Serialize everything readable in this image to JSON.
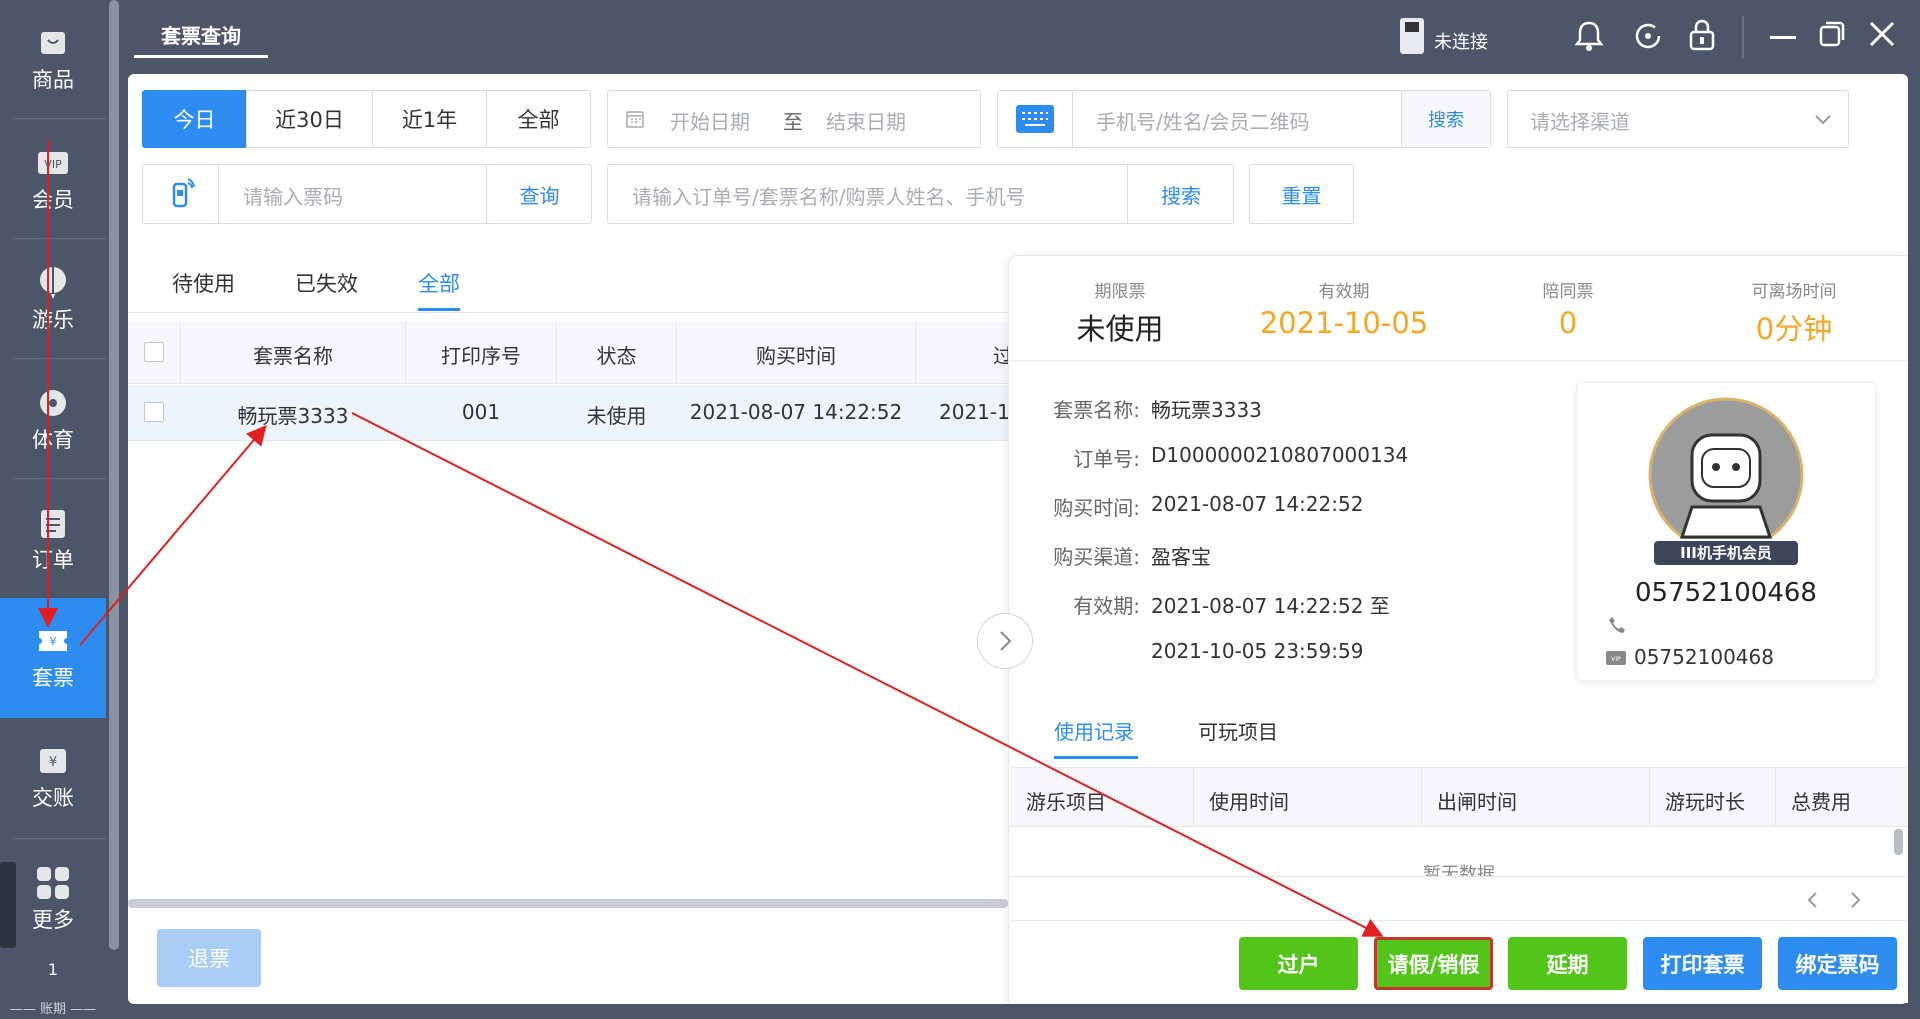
{
  "sidebar": {
    "items": [
      {
        "label": "商品",
        "icon": "shopping-bag-icon"
      },
      {
        "label": "会员",
        "icon": "vip-card-icon"
      },
      {
        "label": "游乐",
        "icon": "balloon-icon"
      },
      {
        "label": "体育",
        "icon": "ball-icon"
      },
      {
        "label": "订单",
        "icon": "clipboard-icon"
      },
      {
        "label": "套票",
        "icon": "ticket-icon"
      },
      {
        "label": "交账",
        "icon": "yen-note-icon"
      },
      {
        "label": "更多",
        "icon": "grid-icon"
      }
    ],
    "active_index": 5,
    "page_number": "1",
    "footer": "—— 账期 ——"
  },
  "header": {
    "tab": "套票查询",
    "device_status": "未连接"
  },
  "filters": {
    "range_buttons": [
      "今日",
      "近30日",
      "近1年",
      "全部"
    ],
    "active_range": 0,
    "start_date": "开始日期",
    "to": "至",
    "end_date": "结束日期",
    "member_placeholder": "手机号/姓名/会员二维码",
    "member_search": "搜索",
    "channel_placeholder": "请选择渠道",
    "ticket_code_placeholder": "请输入票码",
    "query": "查询",
    "order_placeholder": "请输入订单号/套票名称/购票人姓名、手机号",
    "search": "搜索",
    "reset": "重置"
  },
  "status_tabs": [
    "待使用",
    "已失效",
    "全部"
  ],
  "active_status_tab": 2,
  "table": {
    "columns": [
      "套票名称",
      "打印序号",
      "状态",
      "购买时间",
      "过"
    ],
    "rows": [
      {
        "name": "畅玩票3333",
        "serial": "001",
        "status": "未使用",
        "buy_time": "2021-08-07 14:22:52",
        "partial": "2021-1("
      }
    ]
  },
  "refund_button": "退票",
  "detail": {
    "summary": [
      {
        "caption": "期限票",
        "value": "未使用",
        "color": "#222222"
      },
      {
        "caption": "有效期",
        "value": "2021-10-05",
        "color": "#f5a623"
      },
      {
        "caption": "陪同票",
        "value": "0",
        "color": "#f5a623"
      },
      {
        "caption": "可离场时间",
        "value": "0分钟",
        "color": "#f5a623"
      }
    ],
    "fields": [
      {
        "label": "套票名称:",
        "value": "畅玩票3333"
      },
      {
        "label": "订单号:",
        "value": "D1000000210807000134"
      },
      {
        "label": "购买时间:",
        "value": "2021-08-07 14:22:52"
      },
      {
        "label": "购买渠道:",
        "value": "盈客宝"
      },
      {
        "label": "有效期:",
        "value": "2021-08-07 14:22:52 至"
      },
      {
        "label": "",
        "value": "2021-10-05 23:59:59"
      }
    ],
    "member": {
      "badge": "III机手机会员",
      "phone": "05752100468",
      "vip_no": "05752100468"
    },
    "tabs": [
      "使用记录",
      "可玩项目"
    ],
    "active_tab": 0,
    "record_columns": [
      "游乐项目",
      "使用时间",
      "出闸时间",
      "游玩时长",
      "总费用"
    ],
    "empty_text": "暂无数据",
    "actions": [
      {
        "label": "过户",
        "color": "#52c41a"
      },
      {
        "label": "请假/销假",
        "color": "#52c41a"
      },
      {
        "label": "延期",
        "color": "#52c41a"
      },
      {
        "label": "打印套票",
        "color": "#2d8cf0"
      },
      {
        "label": "绑定票码",
        "color": "#2d8cf0"
      }
    ]
  }
}
